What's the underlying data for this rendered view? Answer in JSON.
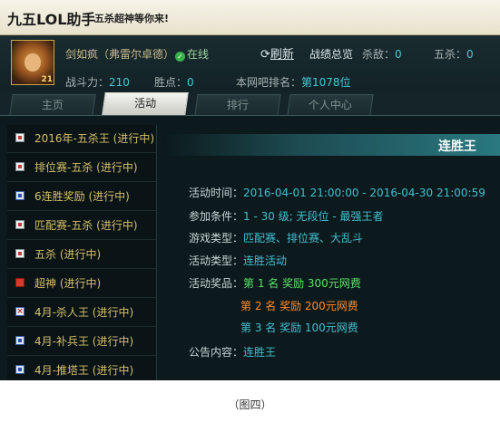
{
  "app": {
    "title": "九五LOL助手",
    "slogan": "五杀超神等你来!"
  },
  "profile": {
    "name": "剑如疯（弗雷尔卓德）",
    "status": "在线",
    "level": "21",
    "refresh_label": "刷新",
    "summary_label": "战绩总览",
    "kills_label": "杀敌：",
    "kills_value": "0",
    "penta_label": "五杀：",
    "penta_value": "0",
    "power_label": "战斗力：",
    "power_value": "210",
    "wins_label": "胜点：",
    "wins_value": "0",
    "rank_label": "本网吧排名：",
    "rank_value": "第1078位"
  },
  "tabs": [
    {
      "label": "主页",
      "active": false
    },
    {
      "label": "活动",
      "active": true
    },
    {
      "label": "排行",
      "active": false
    },
    {
      "label": "个人中心",
      "active": false
    }
  ],
  "sidebar": {
    "items": [
      {
        "label": "2016年-五杀王 (进行中)",
        "icon": "event-flag-icon"
      },
      {
        "label": "排位赛-五杀 (进行中)",
        "icon": "event-flag-icon"
      },
      {
        "label": "6连胜奖励 (进行中)",
        "icon": "blue-badge-icon"
      },
      {
        "label": "匹配赛-五杀 (进行中)",
        "icon": "event-flag-icon"
      },
      {
        "label": "五杀 (进行中)",
        "icon": "event-flag-icon"
      },
      {
        "label": "超神 (进行中)",
        "icon": "red-badge-icon"
      },
      {
        "label": "4月-杀人王 (进行中)",
        "icon": "crossed-swords-icon"
      },
      {
        "label": "4月-补兵王 (进行中)",
        "icon": "blue-badge-icon"
      },
      {
        "label": "4月-推塔王 (进行中)",
        "icon": "blue-badge-icon"
      }
    ]
  },
  "detail": {
    "title": "连胜王",
    "time_label": "活动时间：",
    "time_value": "2016-04-01 21:00:00 - 2016-04-30 21:00:59",
    "cond_label": "参加条件：",
    "cond_value": "1 - 30 级; 无段位 - 最强王者",
    "type_label": "游戏类型：",
    "type_value": "匹配赛、排位赛、大乱斗",
    "kind_label": "活动类型：",
    "kind_value": "连胜活动",
    "reward_label": "活动奖品：",
    "rewards": [
      "第 1 名 奖励 300元网费",
      "第 2 名 奖励 200元网费",
      "第 3 名 奖励 100元网费"
    ],
    "notice_label": "公告内容：",
    "notice_value": "连胜王"
  },
  "caption": "（图四）",
  "colors": {
    "accent": "#42bfd0",
    "gold": "#d6bf6a",
    "green": "#5fe06a",
    "orange": "#ff8a2a"
  }
}
